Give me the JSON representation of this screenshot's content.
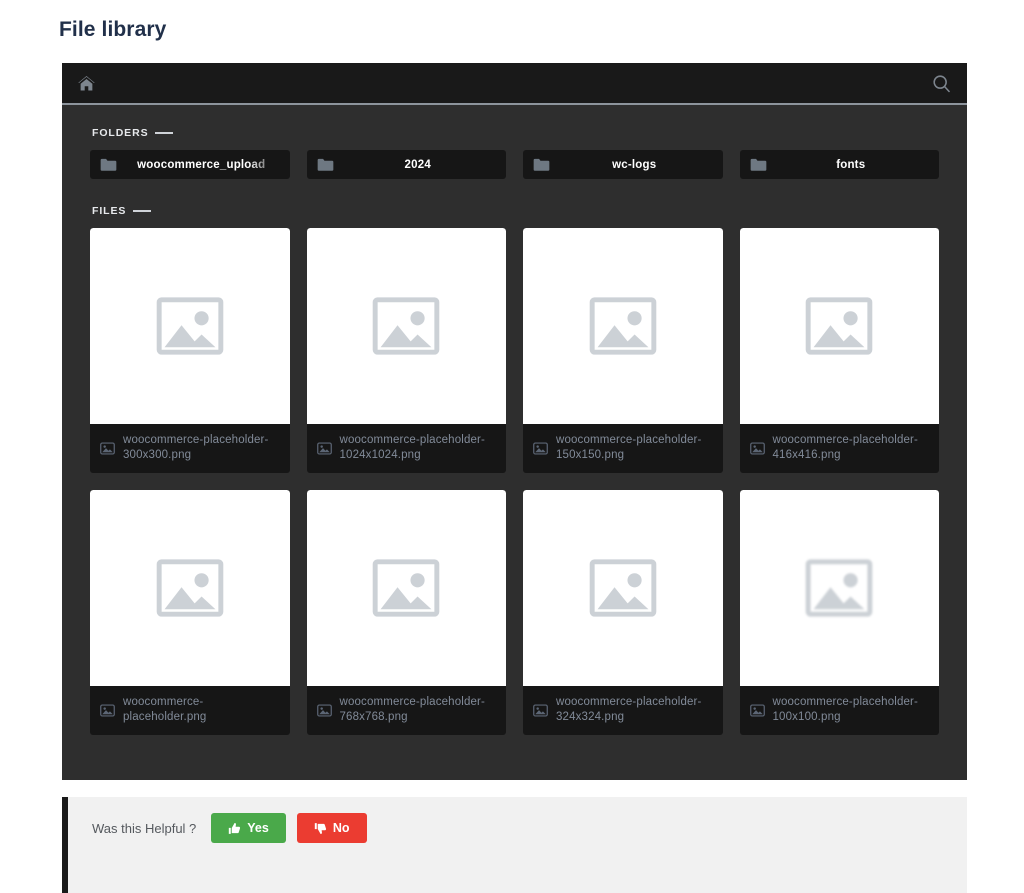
{
  "page": {
    "title": "File library"
  },
  "toolbar": {
    "home_icon": "home-icon",
    "search_icon": "search-icon"
  },
  "sections": {
    "folders_label": "FOLDERS",
    "files_label": "FILES"
  },
  "folders": [
    {
      "name": "woocommerce_upload",
      "icon": "folder-icon"
    },
    {
      "name": "2024",
      "icon": "folder-icon"
    },
    {
      "name": "wc-logs",
      "icon": "folder-icon"
    },
    {
      "name": "fonts",
      "icon": "folder-icon"
    }
  ],
  "files": [
    {
      "name": "woocommerce-placeholder-300x300.png",
      "icon": "image-file-icon",
      "thumb": "image-placeholder"
    },
    {
      "name": "woocommerce-placeholder-1024x1024.png",
      "icon": "image-file-icon",
      "thumb": "image-placeholder"
    },
    {
      "name": "woocommerce-placeholder-150x150.png",
      "icon": "image-file-icon",
      "thumb": "image-placeholder"
    },
    {
      "name": "woocommerce-placeholder-416x416.png",
      "icon": "image-file-icon",
      "thumb": "image-placeholder"
    },
    {
      "name": "woocommerce-placeholder.png",
      "icon": "image-file-icon",
      "thumb": "image-placeholder"
    },
    {
      "name": "woocommerce-placeholder-768x768.png",
      "icon": "image-file-icon",
      "thumb": "image-placeholder"
    },
    {
      "name": "woocommerce-placeholder-324x324.png",
      "icon": "image-file-icon",
      "thumb": "image-placeholder"
    },
    {
      "name": "woocommerce-placeholder-100x100.png",
      "icon": "image-file-icon",
      "thumb": "image-placeholder-blurry"
    }
  ],
  "feedback": {
    "question": "Was this Helpful ?",
    "yes_label": "Yes",
    "no_label": "No",
    "yes_icon": "thumbs-up-icon",
    "no_icon": "thumbs-down-icon",
    "yes_color": "#4aa94a",
    "no_color": "#eb3c31"
  },
  "colors": {
    "title": "#21304a",
    "panel_bg": "#2e2e2e",
    "toolbar_bg": "#191919",
    "card_bg": "#161616",
    "file_name": "#828b99",
    "footer_bg": "#f1f1f1"
  }
}
